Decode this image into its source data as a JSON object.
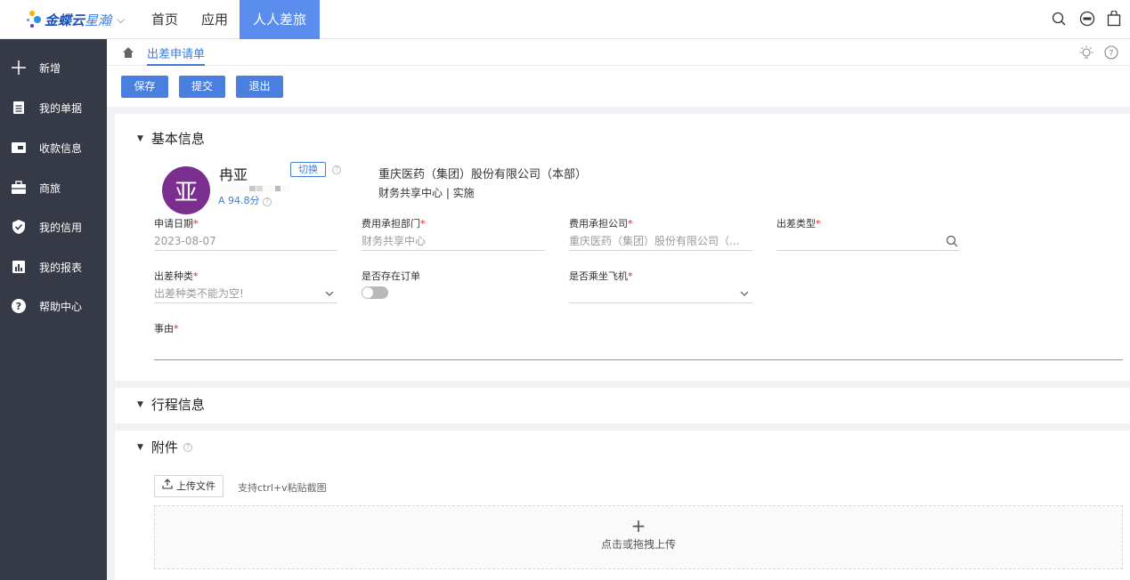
{
  "brand": {
    "name_bold": "金蝶云",
    "name_light": "星瀚"
  },
  "nav": {
    "items": [
      "首页",
      "应用",
      "人人差旅"
    ],
    "active_index": 2
  },
  "sidebar": {
    "items": [
      {
        "label": "新增",
        "icon": "plus-icon"
      },
      {
        "label": "我的单据",
        "icon": "document-icon"
      },
      {
        "label": "收款信息",
        "icon": "wallet-icon"
      },
      {
        "label": "商旅",
        "icon": "briefcase-icon"
      },
      {
        "label": "我的信用",
        "icon": "shield-check-icon"
      },
      {
        "label": "我的报表",
        "icon": "report-icon"
      },
      {
        "label": "帮助中心",
        "icon": "help-icon"
      }
    ]
  },
  "breadcrumb": {
    "current": "出差申请单"
  },
  "toolbar": {
    "save": "保存",
    "submit": "提交",
    "exit": "退出"
  },
  "basic_info": {
    "title": "基本信息",
    "user": {
      "avatar_char": "亚",
      "name": "冉亚",
      "score": "A 94.8分",
      "switch_label": "切换",
      "company": "重庆医药（集团）股份有限公司（本部）",
      "dept": "财务共享中心 | 实施"
    },
    "fields": {
      "apply_date": {
        "label": "申请日期",
        "value": "2023-08-07"
      },
      "cost_dept": {
        "label": "费用承担部门",
        "value": "财务共享中心"
      },
      "cost_company": {
        "label": "费用承担公司",
        "value": "重庆医药（集团）股份有限公司（..."
      },
      "trip_type": {
        "label": "出差类型",
        "value": ""
      },
      "trip_kind": {
        "label": "出差种类",
        "value": "出差种类不能为空!"
      },
      "has_order": {
        "label": "是否存在订单",
        "on": false
      },
      "by_plane": {
        "label": "是否乘坐飞机",
        "value": ""
      },
      "reason": {
        "label": "事由",
        "value": ""
      }
    }
  },
  "itinerary": {
    "title": "行程信息"
  },
  "attachments": {
    "title": "附件",
    "upload_label": "上传文件",
    "upload_hint": "支持ctrl+v粘贴截图",
    "drop_text": "点击或拖拽上传"
  },
  "colors": {
    "primary": "#4a7fe0",
    "nav_active": "#5b8def",
    "sidebar_bg": "#363a46",
    "avatar_bg": "#7a2f8f",
    "required": "#e02020"
  }
}
